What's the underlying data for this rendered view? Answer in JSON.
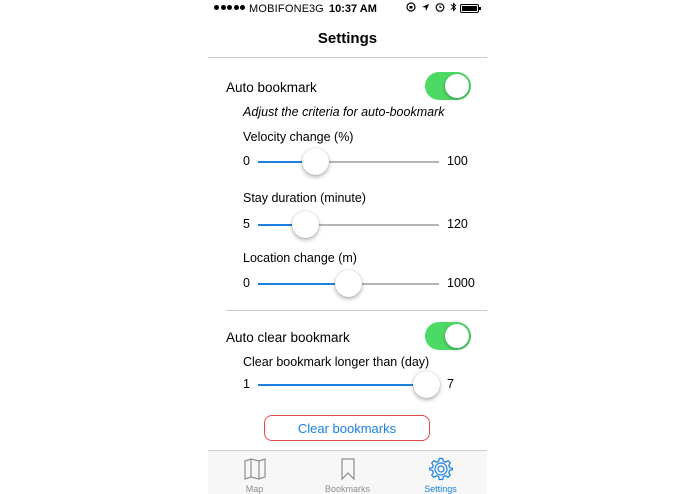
{
  "status_bar": {
    "carrier": "MOBIFONE",
    "network": "3G",
    "time": "10:37 AM"
  },
  "nav": {
    "title": "Settings"
  },
  "auto_bookmark": {
    "label": "Auto bookmark",
    "enabled": true,
    "hint": "Adjust the criteria for auto-bookmark",
    "sliders": [
      {
        "label": "Velocity change (%)",
        "min_label": "0",
        "max_label": "100",
        "min": 0,
        "max": 100,
        "value": 32
      },
      {
        "label": "Stay duration (minute)",
        "min_label": "5",
        "max_label": "120",
        "min": 5,
        "max": 120,
        "value": 35
      },
      {
        "label": "Location change (m)",
        "min_label": "0",
        "max_label": "1000",
        "min": 0,
        "max": 1000,
        "value": 500
      }
    ]
  },
  "auto_clear": {
    "label": "Auto clear bookmark",
    "enabled": true,
    "slider": {
      "label": "Clear bookmark longer than (day)",
      "min_label": "1",
      "max_label": "7",
      "min": 1,
      "max": 7,
      "value": 7
    }
  },
  "clear_button": {
    "label": "Clear bookmarks"
  },
  "tabs": [
    {
      "label": "Map",
      "icon": "map-icon",
      "active": false
    },
    {
      "label": "Bookmarks",
      "icon": "bookmark-icon",
      "active": false
    },
    {
      "label": "Settings",
      "icon": "gear-icon",
      "active": true
    }
  ],
  "colors": {
    "accent": "#1a82e2",
    "toggle_on": "#4cd964",
    "button_border": "#e8484a"
  }
}
